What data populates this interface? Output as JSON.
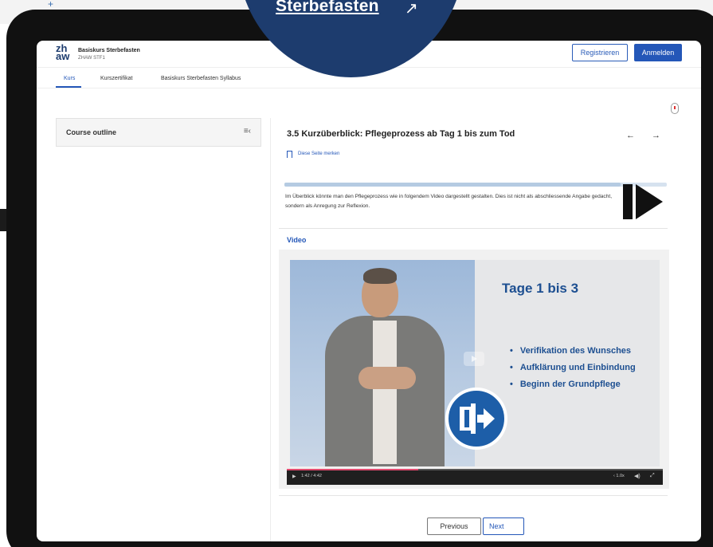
{
  "banner": {
    "text": "Sterbefasten",
    "arrow": "↗"
  },
  "header": {
    "logo_top": "zh",
    "logo_bottom": "aw",
    "title": "Basiskurs Sterbefasten",
    "subtitle": "ZHAW STF1",
    "register_label": "Registrieren",
    "login_label": "Anmelden"
  },
  "tabs": [
    {
      "label": "Kurs",
      "active": true
    },
    {
      "label": "Kurszertifikat",
      "active": false
    },
    {
      "label": "Basiskurs Sterbefasten Syllabus",
      "active": false
    }
  ],
  "sidebar": {
    "outline_label": "Course outline",
    "toggle_icon": "≡‹"
  },
  "content": {
    "title": "3.5 Kurzüberblick: Pflegeprozess ab Tag 1 bis zum Tod",
    "prev_arrow": "←",
    "next_arrow": "→",
    "bookmark_label": "Diese Seite merken",
    "progress": 0.88,
    "intro": "Im Überblick könnte man den Pflegeprozess wie in folgendem Video dargestellt gestalten. Dies ist nicht als abschliessende Angabe gedacht, sondern als Anregung zur Reflexion.",
    "video_heading": "Video"
  },
  "video": {
    "title": "Tage 1 bis 3",
    "bullets": [
      "Verifikation des Wunsches",
      "Aufklärung und Einbindung",
      "Beginn der Grundpflege"
    ],
    "play_icon": "▶",
    "time": "1:42 / 4:42",
    "speed": "‹ 1.0x",
    "volume_icon": "◀)",
    "fullscreen_icon": "⤢",
    "played_fraction": 0.35
  },
  "footer": {
    "previous_label": "Previous",
    "next_label": "Next"
  }
}
